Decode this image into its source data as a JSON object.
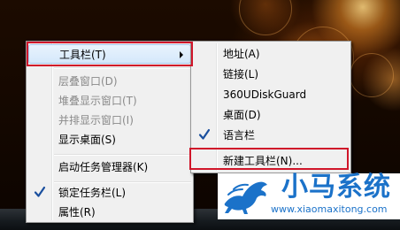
{
  "main_menu": {
    "items": [
      {
        "label": "工具栏(T)",
        "disabled": false,
        "has_submenu": true,
        "selected": true
      },
      {
        "label": "层叠窗口(D)",
        "disabled": true
      },
      {
        "label": "堆叠显示窗口(T)",
        "disabled": true
      },
      {
        "label": "并排显示窗口(I)",
        "disabled": true
      },
      {
        "label": "显示桌面(S)",
        "disabled": false
      },
      {
        "label": "启动任务管理器(K)",
        "disabled": false
      },
      {
        "label": "锁定任务栏(L)",
        "disabled": false,
        "checked": true
      },
      {
        "label": "属性(R)",
        "disabled": false
      }
    ]
  },
  "sub_menu": {
    "items": [
      {
        "label": "地址(A)"
      },
      {
        "label": "链接(L)"
      },
      {
        "label": "360UDiskGuard"
      },
      {
        "label": "桌面(D)"
      },
      {
        "label": "语言栏",
        "checked": true
      },
      {
        "label": "新建工具栏(N)...",
        "highlighted": true
      }
    ]
  },
  "watermark": {
    "title": "小马系统",
    "url": "www.xiaomaxitong.com"
  },
  "colors": {
    "highlight_border": "#d0162a",
    "watermark_blue": "#1b72c9",
    "check_blue": "#1a4f9e"
  }
}
